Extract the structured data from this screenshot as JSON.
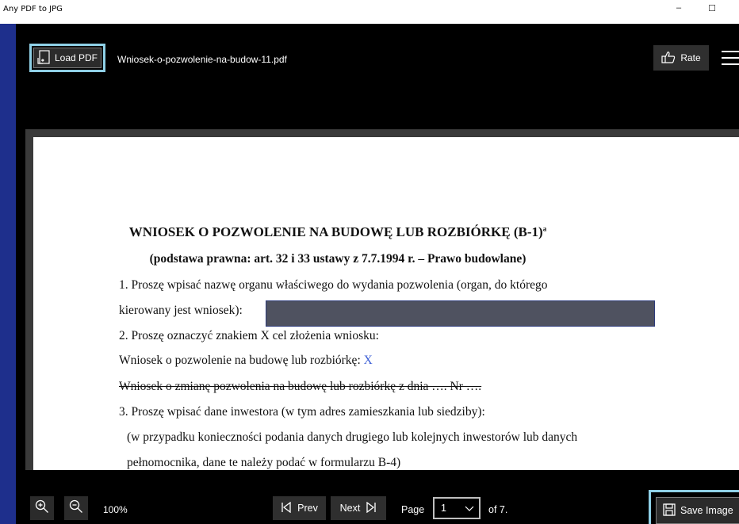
{
  "window": {
    "title": "Any PDF to JPG",
    "minimize": "–",
    "maximize": "☐"
  },
  "toolbar": {
    "load_label": "Load PDF",
    "filename": "Wniosek-o-pozwolenie-na-budow-11.pdf",
    "rate_label": "Rate"
  },
  "document": {
    "heading": "WNIOSEK O POZWOLENIE NA BUDOWĘ LUB ROZBIÓRKĘ (B-1)",
    "heading_sup": "a",
    "subheading": "(podstawa prawna: art. 32 i 33 ustawy z 7.7.1994 r. – Prawo budowlane)",
    "line1a": "1. Proszę  wpisać  nazwę  organu  właściwego  do  wydania  pozwolenia  (organ,  do  którego",
    "line1b": "kierowany jest wniosek):",
    "line2": "2. Proszę oznaczyć znakiem X cel złożenia wniosku:",
    "line3": "Wniosek o pozwolenie na budowę lub rozbiórkę: ",
    "line3_mark": "X",
    "line4": "Wniosek o zmianę pozwolenia na budowę lub rozbiórkę z dnia …. Nr ….",
    "line5": "3. Proszę wpisać dane inwestora (w tym adres zamieszkania lub siedziby):",
    "line6": "(w przypadku konieczności podania danych drugiego lub kolejnych inwestorów lub danych",
    "line7": "pełnomocnika, dane te należy podać w formularzu B-4)"
  },
  "bottom": {
    "zoom": "100%",
    "prev_label": "Prev",
    "next_label": "Next",
    "page_label": "Page",
    "page_value": "1",
    "of_label": "of 7.",
    "save_label": "Save Image"
  },
  "colors": {
    "accent_outline": "#8fd0e6",
    "background": "#1e2f8c",
    "strike_mark": "#3c5fd6"
  }
}
